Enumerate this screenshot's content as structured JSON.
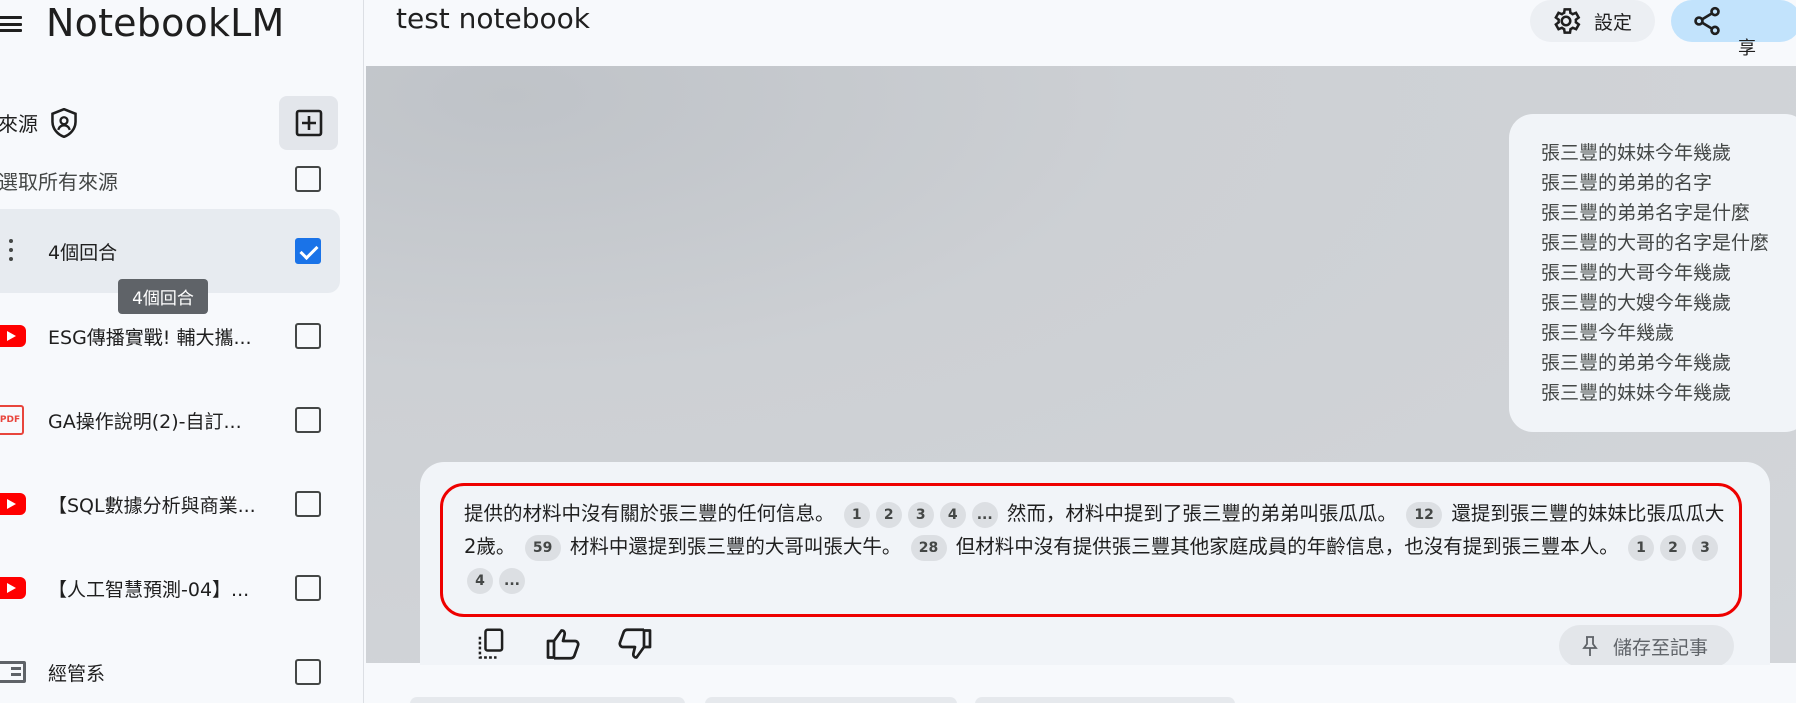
{
  "app": {
    "title": "NotebookLM"
  },
  "sidebar": {
    "sources_label": "來源",
    "select_all_label": "選取所有來源",
    "tooltip": "4個回合",
    "items": [
      {
        "label": "4個回合",
        "type": "note",
        "checked": true
      },
      {
        "label": "ESG傳播實戰! 輔大攜...",
        "type": "youtube",
        "checked": false
      },
      {
        "label": "GA操作說明(2)-自訂...",
        "type": "pdf",
        "checked": false
      },
      {
        "label": "【SQL數據分析與商業...",
        "type": "youtube",
        "checked": false
      },
      {
        "label": "【人工智慧預測-04】...",
        "type": "youtube",
        "checked": false
      },
      {
        "label": "經管系",
        "type": "doc",
        "checked": false
      }
    ]
  },
  "header": {
    "notebook_title": "test notebook",
    "settings_label": "設定",
    "share_label": "享"
  },
  "chat": {
    "user_query_lines": [
      "張三豐的妹妹今年幾歲",
      "張三豐的弟弟的名字",
      "張三豐的弟弟名字是什麼",
      "張三豐的大哥的名字是什麼",
      "張三豐的大哥今年幾歲",
      "張三豐的大嫂今年幾歲",
      "張三豐今年幾歲",
      "張三豐的弟弟今年幾歲",
      "張三豐的妹妹今年幾歲"
    ],
    "answer": {
      "seg1": "提供的材料中沒有關於張三豐的任何信息。",
      "cites1": [
        "1",
        "2",
        "3",
        "4",
        "..."
      ],
      "seg2": "然而，材料中提到了張三豐的弟弟叫張瓜瓜。",
      "cite2": "12",
      "seg3": "還提到張三豐的妹妹比張瓜瓜大2歲。",
      "cite3": "59",
      "seg4": "材料中還提到張三豐的大哥叫張大牛。",
      "cite4": "28",
      "seg5": "但材料中沒有提供張三豐其他家庭成員的年齡信息，也沒有提到張三豐本人。",
      "cites5": [
        "1",
        "2",
        "3",
        "4",
        "..."
      ]
    },
    "save_note_label": "儲存至記事"
  },
  "colors": {
    "accent": "#1a73e8",
    "highlight": "#ee0000",
    "share_bg": "#c2e3fc"
  }
}
